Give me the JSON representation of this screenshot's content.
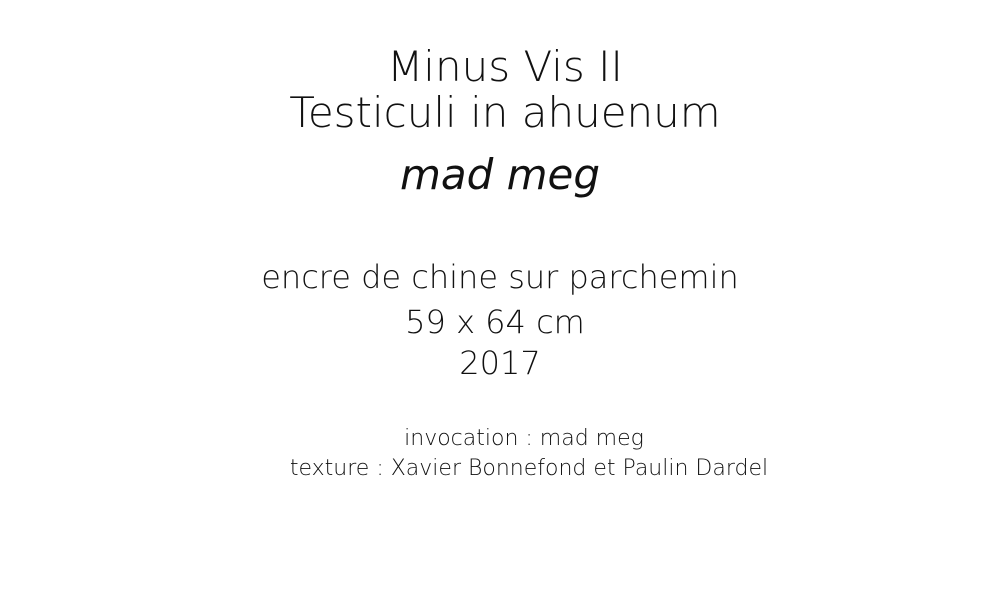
{
  "artwork": {
    "title_line1": "Minus Vis II",
    "title_line2": "Testiculi in ahuenum",
    "artist": "mad meg",
    "medium": "encre de chine sur parchemin",
    "dimensions": "59 x 64 cm",
    "year": "2017"
  },
  "credits": {
    "invocation": "invocation :  mad meg",
    "texture": "texture : Xavier Bonnefond et Paulin Dardel"
  }
}
